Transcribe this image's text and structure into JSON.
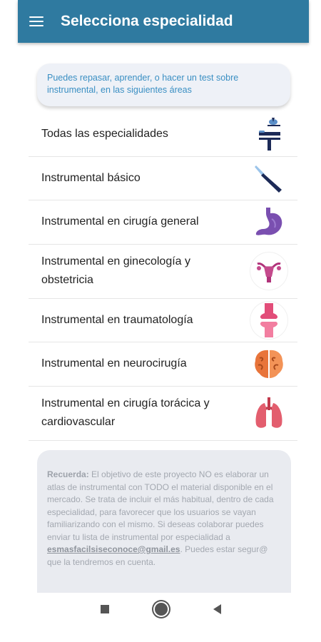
{
  "appbar": {
    "title": "Selecciona especialidad",
    "menu_icon": "hamburger-menu-icon",
    "color": "#2f7aa0"
  },
  "intro": {
    "text": "Puedes repasar, aprender, o hacer un test sobre instrumental, en las siguientes áreas"
  },
  "specialties": [
    {
      "label": "Todas las especialidades",
      "icon": "operating-table-icon"
    },
    {
      "label": "Instrumental básico",
      "icon": "scalpel-icon"
    },
    {
      "label": "Instrumental en cirugía general",
      "icon": "stomach-icon"
    },
    {
      "label": "Instrumental en ginecología y obstetricia",
      "icon": "uterus-icon"
    },
    {
      "label": "Instrumental en traumatología",
      "icon": "knee-joint-icon"
    },
    {
      "label": "Instrumental en neurocirugía",
      "icon": "brain-icon"
    },
    {
      "label": "Instrumental en cirugía torácica y cardiovascular",
      "icon": "lungs-icon"
    }
  ],
  "note": {
    "lead": "Recuerda:",
    "body": " El objetivo de este proyecto NO es elaborar un atlas de instrumental con TODO el material disponible en el mercado. Se trata de incluir el más habitual, dentro de cada especialidad, para favorecer que los usuarios se vayan familiarizando con el mismo. Si deseas colaborar puedes enviar tu lista de instrumental por especialidad a ",
    "email": "esmasfacilsiseconoce@gmail.es",
    "tail": ". Puedes estar segur@ que la tendremos en cuenta."
  },
  "navbar": {
    "recent_icon": "square-recents-icon",
    "home_icon": "circle-home-icon",
    "back_icon": "triangle-back-icon"
  }
}
